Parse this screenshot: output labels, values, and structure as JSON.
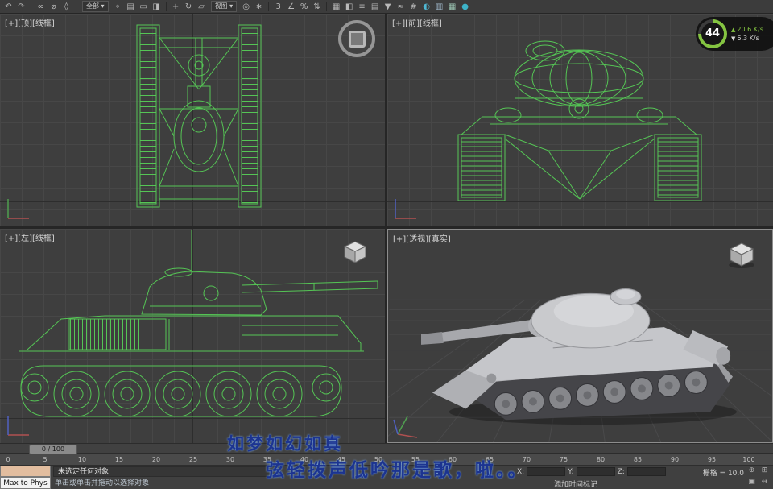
{
  "colors": {
    "wireframe_green": "#55c555",
    "viewport_bg": "#3e3e3e",
    "grid_line": "#474747",
    "grid_major": "#2d2d2d",
    "subtitle_blue": "#1c3490",
    "subtitle_glow": "#8fc1ff",
    "fps_green": "#84c441"
  },
  "toolbar": {
    "items": [
      {
        "type": "icon",
        "name": "undo-icon",
        "glyph": "↶"
      },
      {
        "type": "icon",
        "name": "redo-icon",
        "glyph": "↷"
      },
      {
        "type": "sep"
      },
      {
        "type": "icon",
        "name": "select-link-icon",
        "glyph": "∞"
      },
      {
        "type": "icon",
        "name": "unlink-selection-icon",
        "glyph": "⌀"
      },
      {
        "type": "icon",
        "name": "bind-to-spacewarp-icon",
        "glyph": "◊"
      },
      {
        "type": "sep"
      },
      {
        "type": "dropdown",
        "name": "selection-filter-dropdown",
        "label": "全部"
      },
      {
        "type": "icon",
        "name": "select-object-icon",
        "glyph": "⌖"
      },
      {
        "type": "icon",
        "name": "select-by-name-icon",
        "glyph": "▤"
      },
      {
        "type": "icon",
        "name": "rectangular-selection-region-icon",
        "glyph": "▭"
      },
      {
        "type": "icon",
        "name": "window-crossing-icon",
        "glyph": "◨"
      },
      {
        "type": "sep"
      },
      {
        "type": "icon",
        "name": "select-and-move-icon",
        "glyph": "+"
      },
      {
        "type": "icon",
        "name": "select-and-rotate-icon",
        "glyph": "↻"
      },
      {
        "type": "icon",
        "name": "select-and-scale-icon",
        "glyph": "▱"
      },
      {
        "type": "dropdown",
        "name": "reference-coordinate-system-dropdown",
        "label": "视图"
      },
      {
        "type": "icon",
        "name": "use-pivot-point-icon",
        "glyph": "◎"
      },
      {
        "type": "icon",
        "name": "select-and-manipulate-icon",
        "glyph": "∗"
      },
      {
        "type": "sep"
      },
      {
        "type": "icon",
        "name": "snaps-toggle-icon",
        "glyph": "3"
      },
      {
        "type": "icon",
        "name": "angle-snap-icon",
        "glyph": "∠"
      },
      {
        "type": "icon",
        "name": "percent-snap-icon",
        "glyph": "%"
      },
      {
        "type": "icon",
        "name": "spinner-snap-icon",
        "glyph": "⇅"
      },
      {
        "type": "sep"
      },
      {
        "type": "icon",
        "name": "edit-named-selection-sets-icon",
        "glyph": "▦"
      },
      {
        "type": "icon",
        "name": "mirror-icon",
        "glyph": "◧"
      },
      {
        "type": "icon",
        "name": "align-icon",
        "glyph": "≡"
      },
      {
        "type": "icon",
        "name": "layer-manager-icon",
        "glyph": "▤"
      },
      {
        "type": "icon",
        "name": "graphite-ribbon-icon",
        "glyph": "▼"
      },
      {
        "type": "icon",
        "name": "curve-editor-icon",
        "glyph": "≈"
      },
      {
        "type": "icon",
        "name": "schematic-view-icon",
        "glyph": "#"
      },
      {
        "type": "icon",
        "name": "material-editor-icon",
        "glyph": "◐",
        "color": "#4fb7d3"
      },
      {
        "type": "icon",
        "name": "render-setup-icon",
        "glyph": "▥",
        "color": "#9fb7c9"
      },
      {
        "type": "icon",
        "name": "rendered-frame-window-icon",
        "glyph": "▦",
        "color": "#9fc9b7"
      },
      {
        "type": "icon",
        "name": "render-production-icon",
        "glyph": "●",
        "color": "#3db3c8"
      }
    ]
  },
  "fps_overlay": {
    "fps": "44",
    "up": "20.6 K/s",
    "down": "6.3 K/s"
  },
  "viewports": {
    "top_left": {
      "label": "[+][顶][线框]"
    },
    "top_right": {
      "label": "[+][前][线框]"
    },
    "bottom_left": {
      "label": "[+][左][线框]"
    },
    "bottom_right": {
      "label": "[+][透视][真实]"
    }
  },
  "timeline": {
    "slider_label": "0 / 100",
    "ticks": [
      "0",
      "5",
      "10",
      "15",
      "20",
      "25",
      "30",
      "35",
      "40",
      "45",
      "50",
      "55",
      "60",
      "65",
      "70",
      "75",
      "80",
      "85",
      "90",
      "95",
      "100"
    ]
  },
  "statusbar": {
    "script_button": "Max to Phys",
    "selection_status": "未选定任何对象",
    "prompt": "单击或单击并拖动以选择对象",
    "x_label": "X:",
    "y_label": "Y:",
    "z_label": "Z:",
    "x_value": "",
    "y_value": "",
    "z_value": "",
    "grid_label": "栅格 = 10.0",
    "add_time_tag": "添加时间标记"
  },
  "nav_controls": [
    {
      "name": "zoom-icon",
      "glyph": "⊕"
    },
    {
      "name": "zoom-all-icon",
      "glyph": "⊞"
    },
    {
      "name": "maximize-viewport-icon",
      "glyph": "▣"
    },
    {
      "name": "pan-icon",
      "glyph": "↔"
    }
  ],
  "subtitles": {
    "line1": "如梦如幻如真",
    "line2": "弦轻拨声低吟那是歌，啦。。"
  }
}
